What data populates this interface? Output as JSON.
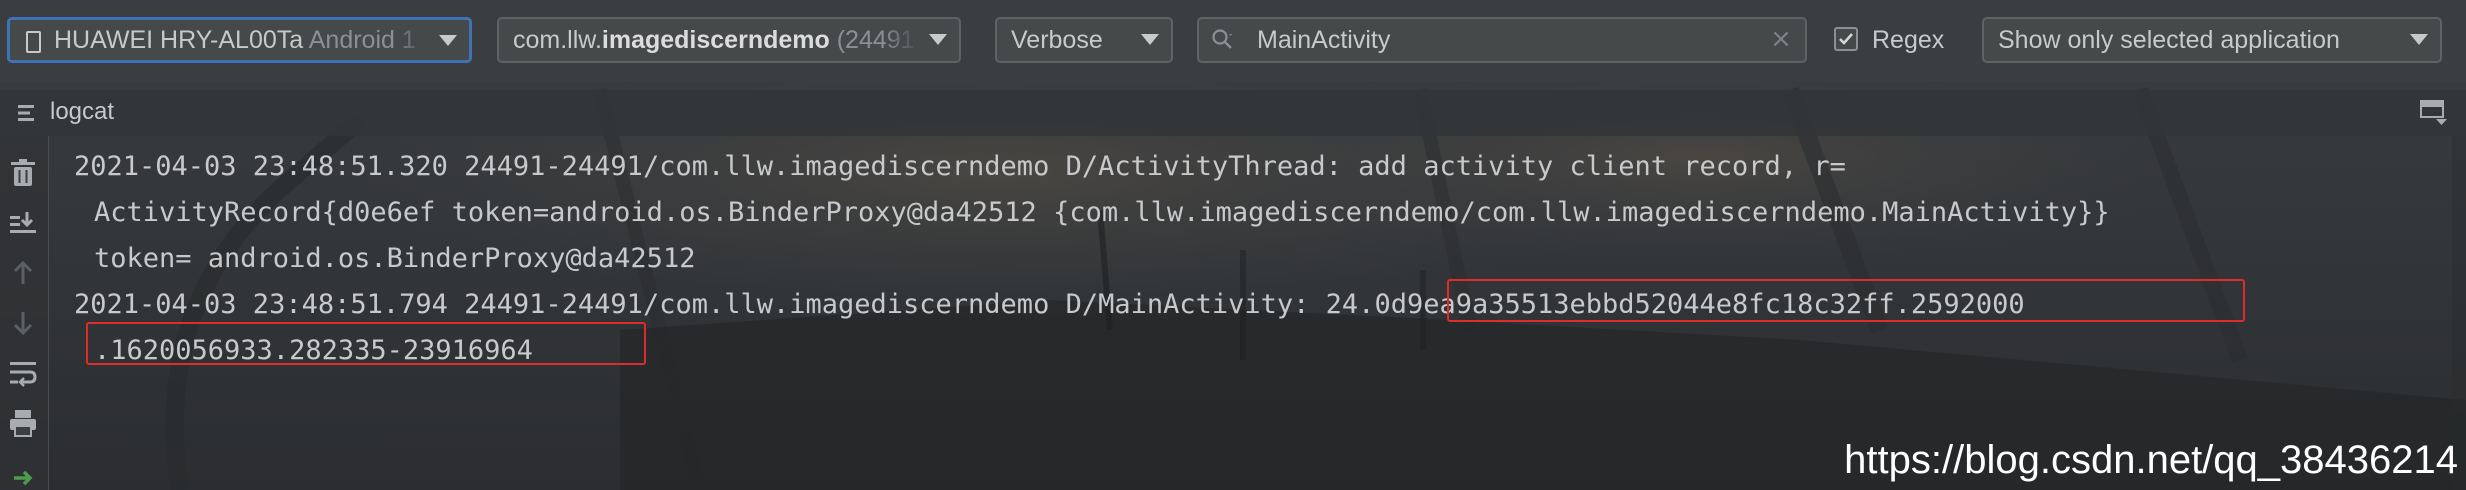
{
  "toolbar": {
    "device": {
      "name": "HUAWEI HRY-AL00Ta",
      "os": "Android 1"
    },
    "process": {
      "package_prefix": "com.llw.",
      "package_name": "imagediscerndemo",
      "pid": "(24491"
    },
    "log_level": "Verbose",
    "search": {
      "value": "MainActivity"
    },
    "regex": {
      "label": "Regex",
      "checked": true
    },
    "filter": "Show only selected application"
  },
  "panel": {
    "title": "logcat"
  },
  "log": {
    "entries": [
      {
        "lines": [
          "2021-04-03 23:48:51.320 24491-24491/com.llw.imagediscerndemo D/ActivityThread: add activity client record, r=",
          "ActivityRecord{d0e6ef token=android.os.BinderProxy@da42512 {com.llw.imagediscerndemo/com.llw.imagediscerndemo.MainActivity}}",
          "token= android.os.BinderProxy@da42512"
        ]
      },
      {
        "prefix": "2021-04-03 23:48:51.794 24491-24491/com.llw.imagediscerndemo D/MainActivity: ",
        "highlight_1": "24.0d9ea9a35513ebbd52044e8fc18c32ff.2592000",
        "highlight_2": ".1620056933.282335-23916964"
      }
    ]
  },
  "watermark": "https://blog.csdn.net/qq_38436214",
  "colors": {
    "highlight_border": "#e02b2b",
    "focus_border": "#3f72b4",
    "text": "#c7c9cb"
  },
  "icons": {
    "left_toolbar": [
      "trash-icon",
      "scroll-to-end-icon",
      "up-arrow-icon",
      "down-arrow-icon",
      "soft-wrap-icon",
      "print-icon",
      "restart-icon"
    ]
  }
}
